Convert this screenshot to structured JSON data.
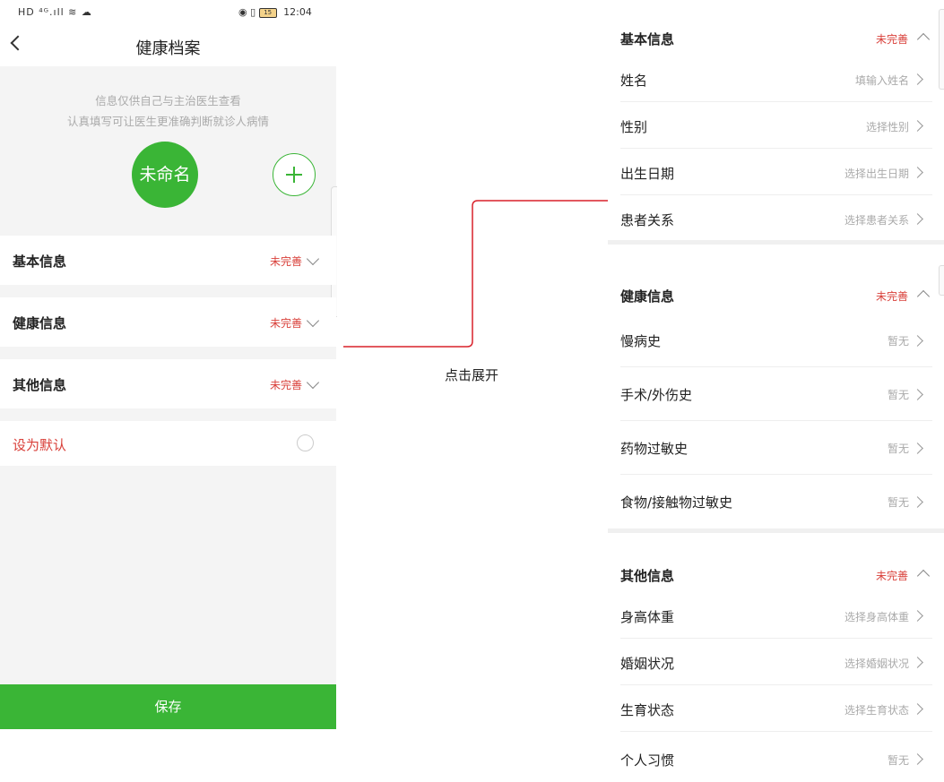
{
  "statusbar": {
    "left_icons": "HD ⁴ᴳ.ıll ≋ ☁",
    "right_icons": "◉ ▯",
    "battery": "15",
    "time": "12:04"
  },
  "left": {
    "title": "健康档案",
    "intro_line1": "信息仅供自己与主治医生查看",
    "intro_line2": "认真填写可让医生更准确判断就诊人病情",
    "avatar_text": "未命名",
    "sections": [
      {
        "label": "基本信息",
        "status": "未完善"
      },
      {
        "label": "健康信息",
        "status": "未完善"
      },
      {
        "label": "其他信息",
        "status": "未完善"
      }
    ],
    "set_default": "设为默认",
    "save": "保存"
  },
  "connector_label": "点击展开",
  "right": {
    "basic": {
      "label": "基本信息",
      "status": "未完善",
      "items": [
        {
          "label": "姓名",
          "value": "填输入姓名"
        },
        {
          "label": "性别",
          "value": "选择性别"
        },
        {
          "label": "出生日期",
          "value": "选择出生日期"
        },
        {
          "label": "患者关系",
          "value": "选择患者关系"
        }
      ]
    },
    "health": {
      "label": "健康信息",
      "status": "未完善",
      "items": [
        {
          "label": "慢病史",
          "value": "暂无"
        },
        {
          "label": "手术/外伤史",
          "value": "暂无"
        },
        {
          "label": "药物过敏史",
          "value": "暂无"
        },
        {
          "label": "食物/接触物过敏史",
          "value": "暂无"
        }
      ]
    },
    "other": {
      "label": "其他信息",
      "status": "未完善",
      "items": [
        {
          "label": "身高体重",
          "value": "选择身高体重"
        },
        {
          "label": "婚姻状况",
          "value": "选择婚姻状况"
        },
        {
          "label": "生育状态",
          "value": "选择生育状态"
        },
        {
          "label": "个人习惯",
          "value": "暂无"
        }
      ]
    }
  },
  "colors": {
    "accent": "#3ab536",
    "warning": "#d9403a",
    "connector": "#d9202a"
  }
}
